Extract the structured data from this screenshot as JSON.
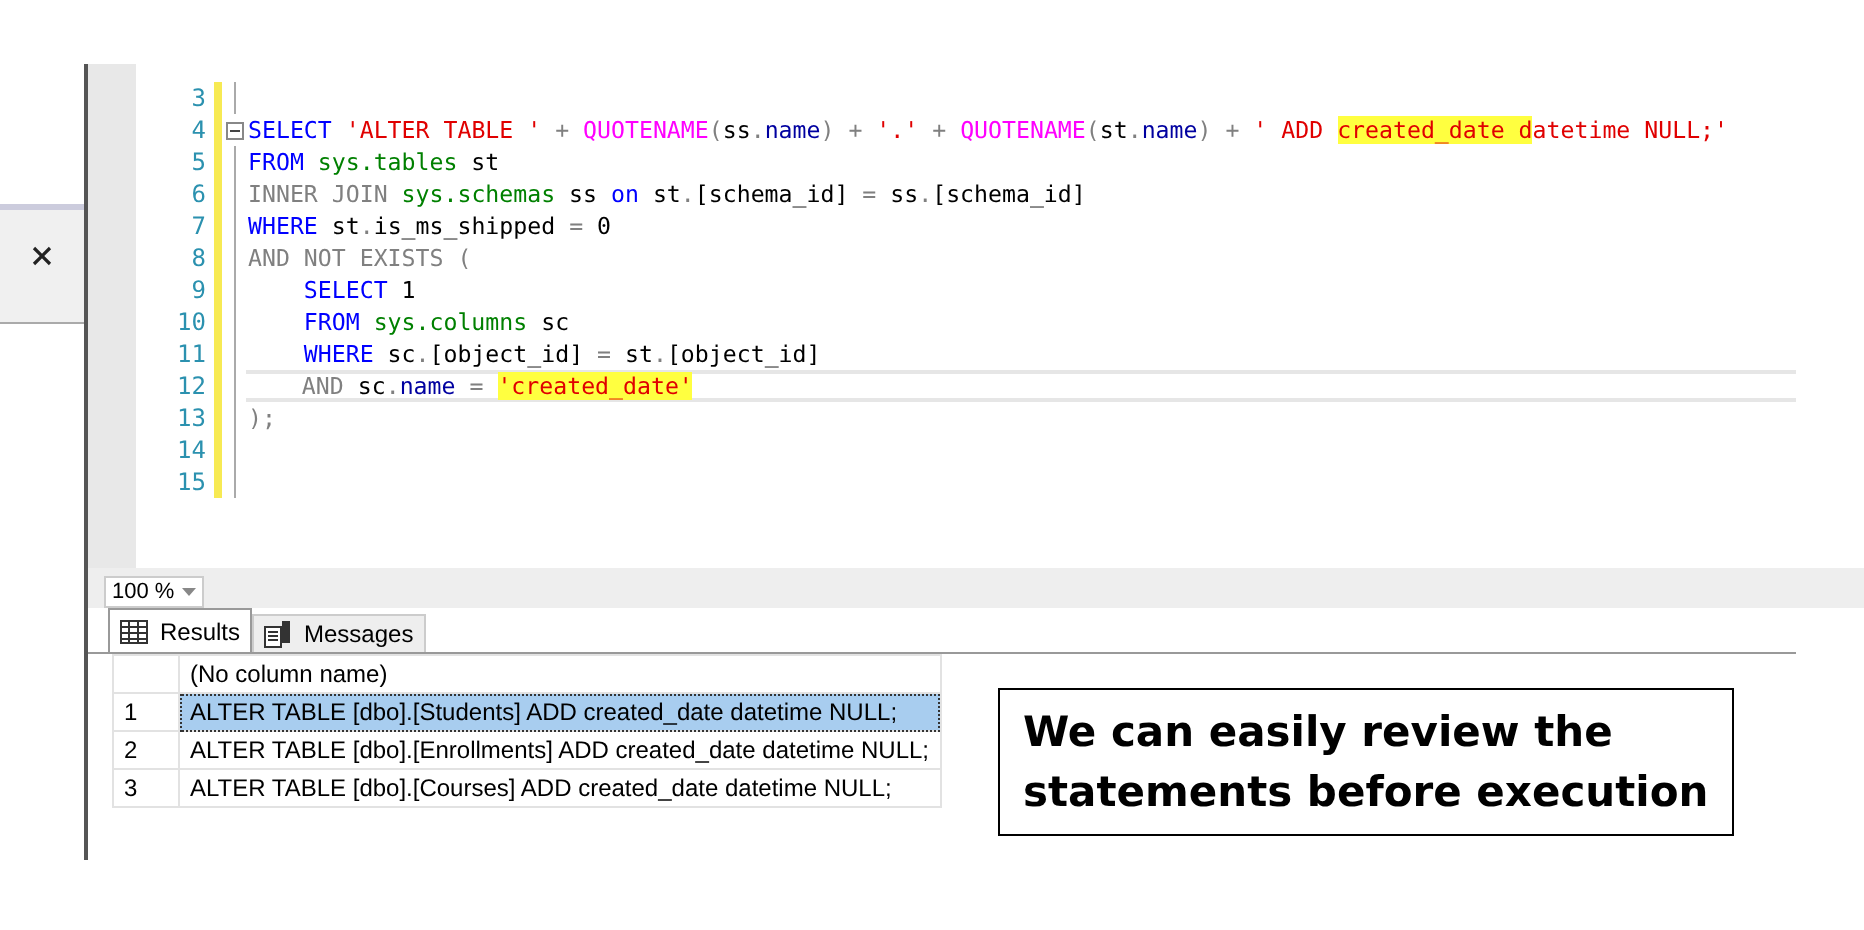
{
  "editor": {
    "lines": [
      {
        "number": "3",
        "current": false
      },
      {
        "number": "4",
        "current": false,
        "fold": true,
        "tokens": [
          {
            "kind": "kw",
            "t": "SELECT"
          },
          {
            "kind": "str",
            "t": " 'ALTER TABLE '"
          },
          {
            "kind": "op",
            "t": " + "
          },
          {
            "kind": "fn",
            "t": "QUOTENAME"
          },
          {
            "kind": "op",
            "t": "("
          },
          {
            "kind": "id",
            "t": "ss"
          },
          {
            "kind": "op",
            "t": "."
          },
          {
            "kind": "mem",
            "t": "name"
          },
          {
            "kind": "op",
            "t": ") + "
          },
          {
            "kind": "str",
            "t": "'.'"
          },
          {
            "kind": "op",
            "t": " + "
          },
          {
            "kind": "fn",
            "t": "QUOTENAME"
          },
          {
            "kind": "op",
            "t": "("
          },
          {
            "kind": "id",
            "t": "st"
          },
          {
            "kind": "op",
            "t": "."
          },
          {
            "kind": "mem",
            "t": "name"
          },
          {
            "kind": "op",
            "t": ") + "
          },
          {
            "kind": "str",
            "t": "' ADD "
          },
          {
            "kind": "str",
            "t": "created_date d",
            "highlight": true
          },
          {
            "kind": "str",
            "t": "atetime NULL;'"
          }
        ]
      },
      {
        "number": "5",
        "current": false,
        "tokens": [
          {
            "kind": "kw",
            "t": "FROM"
          },
          {
            "kind": "sys",
            "t": " sys.tables"
          },
          {
            "kind": "id",
            "t": " st"
          }
        ]
      },
      {
        "number": "6",
        "current": false,
        "tokens": [
          {
            "kind": "op",
            "t": "INNER JOIN"
          },
          {
            "kind": "sys",
            "t": " sys.schemas"
          },
          {
            "kind": "id",
            "t": " ss "
          },
          {
            "kind": "kw",
            "t": "on"
          },
          {
            "kind": "id",
            "t": " st"
          },
          {
            "kind": "op",
            "t": "."
          },
          {
            "kind": "id",
            "t": "[schema_id] "
          },
          {
            "kind": "op",
            "t": "="
          },
          {
            "kind": "id",
            "t": " ss"
          },
          {
            "kind": "op",
            "t": "."
          },
          {
            "kind": "id",
            "t": "[schema_id]"
          }
        ]
      },
      {
        "number": "7",
        "current": false,
        "tokens": [
          {
            "kind": "kw",
            "t": "WHERE"
          },
          {
            "kind": "id",
            "t": " st"
          },
          {
            "kind": "op",
            "t": "."
          },
          {
            "kind": "id",
            "t": "is_ms_shipped "
          },
          {
            "kind": "op",
            "t": "="
          },
          {
            "kind": "id",
            "t": " 0"
          }
        ]
      },
      {
        "number": "8",
        "current": false,
        "tokens": [
          {
            "kind": "op",
            "t": "AND NOT EXISTS ("
          }
        ]
      },
      {
        "number": "9",
        "current": false,
        "tokens": [
          {
            "kind": "kw",
            "t": "    SELECT"
          },
          {
            "kind": "id",
            "t": " 1"
          }
        ]
      },
      {
        "number": "10",
        "current": false,
        "tokens": [
          {
            "kind": "kw",
            "t": "    FROM"
          },
          {
            "kind": "sys",
            "t": " sys.columns"
          },
          {
            "kind": "id",
            "t": " sc"
          }
        ]
      },
      {
        "number": "11",
        "current": false,
        "tokens": [
          {
            "kind": "kw",
            "t": "    WHERE"
          },
          {
            "kind": "id",
            "t": " sc"
          },
          {
            "kind": "op",
            "t": "."
          },
          {
            "kind": "id",
            "t": "[object_id] "
          },
          {
            "kind": "op",
            "t": "="
          },
          {
            "kind": "id",
            "t": " st"
          },
          {
            "kind": "op",
            "t": "."
          },
          {
            "kind": "id",
            "t": "[object_id]"
          }
        ]
      },
      {
        "number": "12",
        "current": true,
        "tokens": [
          {
            "kind": "op",
            "t": "    AND"
          },
          {
            "kind": "id",
            "t": " sc"
          },
          {
            "kind": "op",
            "t": "."
          },
          {
            "kind": "mem",
            "t": "name"
          },
          {
            "kind": "op",
            "t": " = "
          },
          {
            "kind": "str",
            "t": "'created_date'",
            "highlight": true
          }
        ]
      },
      {
        "number": "13",
        "current": false,
        "tokens": [
          {
            "kind": "op",
            "t": ");"
          }
        ]
      },
      {
        "number": "14",
        "current": false
      },
      {
        "number": "15",
        "current": false
      }
    ]
  },
  "zoom": {
    "value": "100 %"
  },
  "result_tabs": [
    {
      "label": "Results",
      "selected": true,
      "kind": "grid"
    },
    {
      "label": "Messages",
      "selected": false,
      "kind": "messages"
    }
  ],
  "results": {
    "columns": [
      "(No column name)"
    ],
    "rows": [
      {
        "number": "1",
        "value": "ALTER TABLE [dbo].[Students] ADD created_date datetime NULL;",
        "selected": true
      },
      {
        "number": "2",
        "value": "ALTER TABLE [dbo].[Enrollments] ADD created_date datetime NULL;",
        "selected": false
      },
      {
        "number": "3",
        "value": "ALTER TABLE [dbo].[Courses] ADD created_date datetime NULL;",
        "selected": false
      }
    ]
  },
  "callout": {
    "lines": [
      "We can easily review the",
      "statements before execution"
    ]
  }
}
